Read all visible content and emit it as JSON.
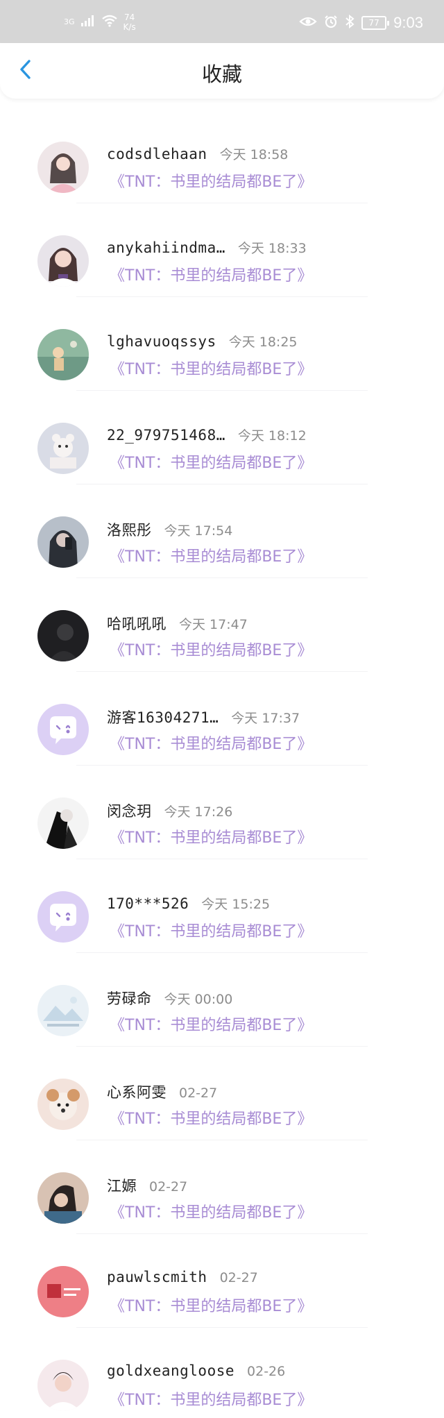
{
  "status_bar": {
    "network": "3G",
    "speed_value": "74",
    "speed_unit": "K/s",
    "battery": "77",
    "time": "9:03"
  },
  "nav": {
    "title": "收藏",
    "back_icon": "chevron-left-icon"
  },
  "colors": {
    "accent": "#2a95e0",
    "message": "#a88cd4",
    "status_bar": "#d6d6d6"
  },
  "items": [
    {
      "name": "codsdlehaan",
      "time": "今天 18:58",
      "message": "《TNT：书里的结局都BE了》"
    },
    {
      "name": "anykahiindma…",
      "time": "今天 18:33",
      "message": "《TNT：书里的结局都BE了》"
    },
    {
      "name": "lghavuoqssys",
      "time": "今天 18:25",
      "message": "《TNT：书里的结局都BE了》"
    },
    {
      "name": "22_979751468…",
      "time": "今天 18:12",
      "message": "《TNT：书里的结局都BE了》"
    },
    {
      "name": "洛熙彤",
      "time": "今天 17:54",
      "message": "《TNT：书里的结局都BE了》"
    },
    {
      "name": "哈吼吼吼",
      "time": "今天 17:47",
      "message": "《TNT：书里的结局都BE了》"
    },
    {
      "name": "游客16304271…",
      "time": "今天 17:37",
      "message": "《TNT：书里的结局都BE了》"
    },
    {
      "name": "闵念玥",
      "time": "今天 17:26",
      "message": "《TNT：书里的结局都BE了》"
    },
    {
      "name": "170***526",
      "time": "今天 15:25",
      "message": "《TNT：书里的结局都BE了》"
    },
    {
      "name": "劳碌命",
      "time": "今天 00:00",
      "message": "《TNT：书里的结局都BE了》"
    },
    {
      "name": "心系阿雯",
      "time": "02-27",
      "message": "《TNT：书里的结局都BE了》"
    },
    {
      "name": "江嫄",
      "time": "02-27",
      "message": "《TNT：书里的结局都BE了》"
    },
    {
      "name": "pauwlscmith",
      "time": "02-27",
      "message": "《TNT：书里的结局都BE了》"
    },
    {
      "name": "goldxeangloose",
      "time": "02-26",
      "message": "《TNT：书里的结局都BE了》"
    }
  ]
}
